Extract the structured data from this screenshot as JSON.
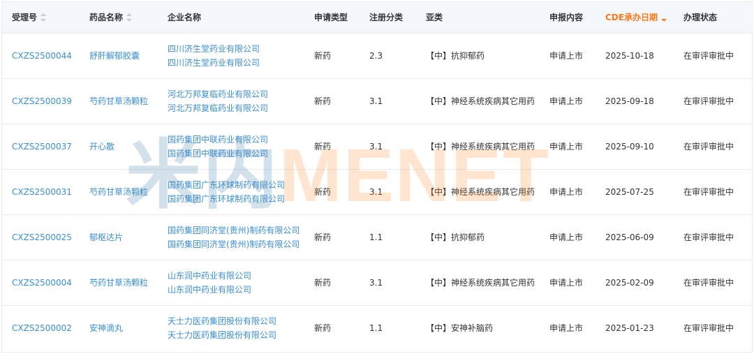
{
  "colors": {
    "link": "#3a8fd4",
    "active_sort": "#ff7a1a",
    "header_bg": "#f4f7fb",
    "watermark_cn": "#3b79a8",
    "watermark_en": "#ff8a2b"
  },
  "columns": [
    {
      "label": "受理号",
      "sortable": true,
      "active": false
    },
    {
      "label": "药品名称",
      "sortable": true,
      "active": false
    },
    {
      "label": "企业名称",
      "sortable": false,
      "active": false
    },
    {
      "label": "申请类型",
      "sortable": false,
      "active": false
    },
    {
      "label": "注册分类",
      "sortable": false,
      "active": false
    },
    {
      "label": "亚类",
      "sortable": false,
      "active": false
    },
    {
      "label": "申报内容",
      "sortable": false,
      "active": false
    },
    {
      "label": "CDE承办日期",
      "sortable": true,
      "active": true
    },
    {
      "label": "办理状态",
      "sortable": false,
      "active": false
    }
  ],
  "rows": [
    {
      "acceptance_no": "CXZS2500044",
      "drug_name": "舒肝解郁胶囊",
      "companies": [
        "四川济生堂药业有限公司",
        "四川济生堂药业有限公司"
      ],
      "app_type": "新药",
      "reg_class": "2.3",
      "subclass": "【中】抗抑郁药",
      "content": "申请上市",
      "date": "2025-10-18",
      "status": "在审评审批中"
    },
    {
      "acceptance_no": "CXZS2500039",
      "drug_name": "芍药甘草汤颗粒",
      "companies": [
        "河北万邦复临药业有限公司",
        "河北万邦复临药业有限公司"
      ],
      "app_type": "新药",
      "reg_class": "3.1",
      "subclass": "【中】神经系统疾病其它用药",
      "content": "申请上市",
      "date": "2025-09-18",
      "status": "在审评审批中"
    },
    {
      "acceptance_no": "CXZS2500037",
      "drug_name": "开心散",
      "companies": [
        "国药集团中联药业有限公司",
        "国药集团中联药业有限公司"
      ],
      "app_type": "新药",
      "reg_class": "3.1",
      "subclass": "【中】神经系统疾病其它用药",
      "content": "申请上市",
      "date": "2025-09-10",
      "status": "在审评审批中"
    },
    {
      "acceptance_no": "CXZS2500031",
      "drug_name": "芍药甘草汤颗粒",
      "companies": [
        "国药集团广东环球制药有限公司",
        "国药集团广东环球制药有限公司"
      ],
      "app_type": "新药",
      "reg_class": "3.1",
      "subclass": "【中】神经系统疾病其它用药",
      "content": "申请上市",
      "date": "2025-07-25",
      "status": "在审评审批中"
    },
    {
      "acceptance_no": "CXZS2500025",
      "drug_name": "郁枢达片",
      "companies": [
        "国药集团同济堂(贵州)制药有限公司",
        "国药集团同济堂(贵州)制药有限公司"
      ],
      "app_type": "新药",
      "reg_class": "1.1",
      "subclass": "【中】抗抑郁药",
      "content": "申请上市",
      "date": "2025-06-09",
      "status": "在审评审批中"
    },
    {
      "acceptance_no": "CXZS2500004",
      "drug_name": "芍药甘草汤颗粒",
      "companies": [
        "山东润中药业有限公司",
        "山东润中药业有限公司"
      ],
      "app_type": "新药",
      "reg_class": "3.1",
      "subclass": "【中】神经系统疾病其它用药",
      "content": "申请上市",
      "date": "2025-02-09",
      "status": "在审评审批中"
    },
    {
      "acceptance_no": "CXZS2500002",
      "drug_name": "安神滴丸",
      "companies": [
        "天士力医药集团股份有限公司",
        "天士力医药集团股份有限公司"
      ],
      "app_type": "新药",
      "reg_class": "1.1",
      "subclass": "【中】安神补脑药",
      "content": "申请上市",
      "date": "2025-01-23",
      "status": "在审评审批中"
    }
  ],
  "watermark": {
    "cn": "米内",
    "en": "MENET"
  }
}
